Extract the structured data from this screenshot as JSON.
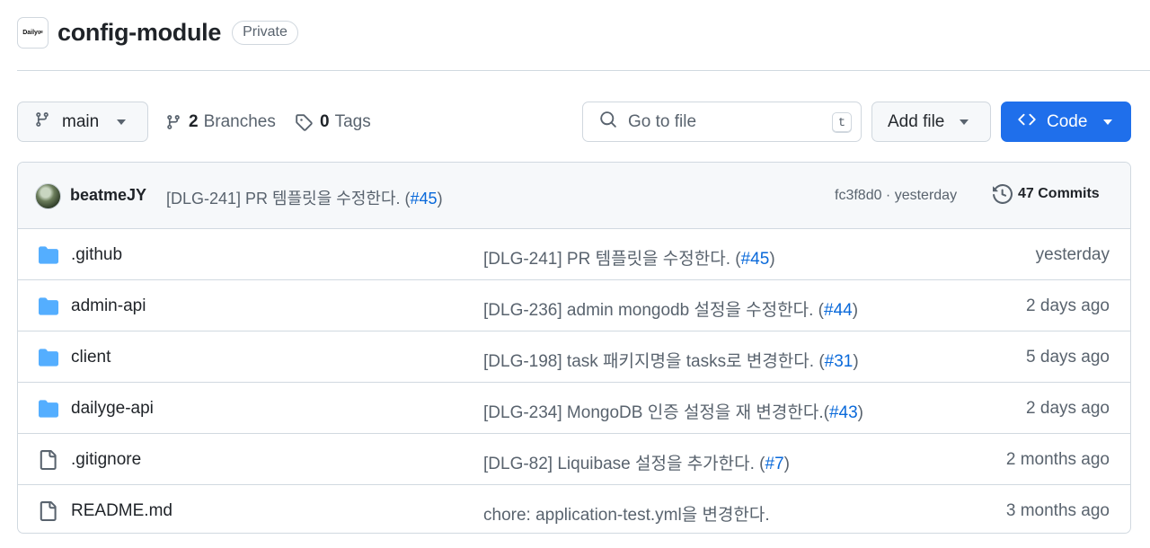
{
  "repo": {
    "logo_text": "Daily",
    "logo_sub": "ge",
    "name": "config-module",
    "visibility": "Private"
  },
  "toolbar": {
    "branch": "main",
    "branches_count": "2",
    "branches_label": "Branches",
    "tags_count": "0",
    "tags_label": "Tags",
    "search_placeholder": "Go to file",
    "search_shortcut": "t",
    "add_file_label": "Add file",
    "code_label": "Code"
  },
  "latest_commit": {
    "author": "beatmeJY",
    "message_prefix": "[DLG-241] PR 템플릿을 수정한다. (",
    "pr": "#45",
    "message_suffix": ")",
    "sha_time": "fc3f8d0 · yesterday",
    "commits_count": "47 Commits"
  },
  "files": [
    {
      "type": "folder",
      "name": ".github",
      "msg_prefix": "[DLG-241] PR 템플릿을 수정한다. (",
      "pr": "#45",
      "msg_suffix": ")",
      "date": "yesterday"
    },
    {
      "type": "folder",
      "name": "admin-api",
      "msg_prefix": "[DLG-236] admin mongodb 설정을 수정한다. (",
      "pr": "#44",
      "msg_suffix": ")",
      "date": "2 days ago"
    },
    {
      "type": "folder",
      "name": "client",
      "msg_prefix": "[DLG-198] task 패키지명을 tasks로 변경한다. (",
      "pr": "#31",
      "msg_suffix": ")",
      "date": "5 days ago"
    },
    {
      "type": "folder",
      "name": "dailyge-api",
      "msg_prefix": "[DLG-234] MongoDB 인증 설정을 재 변경한다.(",
      "pr": "#43",
      "msg_suffix": ")",
      "date": "2 days ago"
    },
    {
      "type": "file",
      "name": ".gitignore",
      "msg_prefix": "[DLG-82] Liquibase 설정을 추가한다. (",
      "pr": "#7",
      "msg_suffix": ")",
      "date": "2 months ago"
    },
    {
      "type": "file",
      "name": "README.md",
      "msg_prefix": "chore: application-test.yml을 변경한다.",
      "pr": "",
      "msg_suffix": "",
      "date": "3 months ago"
    }
  ],
  "colors": {
    "accent": "#1f6feb",
    "link": "#0969da",
    "folder": "#54aeff",
    "muted": "#59636e"
  }
}
